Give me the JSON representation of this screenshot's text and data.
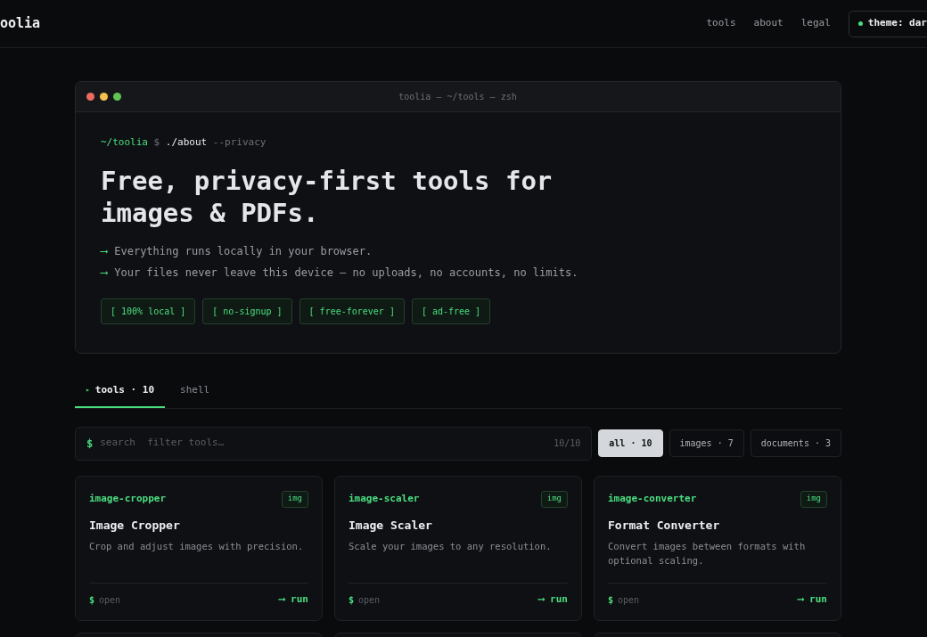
{
  "header": {
    "logo": "oolia",
    "nav": [
      {
        "label": "tools"
      },
      {
        "label": "about"
      },
      {
        "label": "legal"
      }
    ],
    "theme_button": {
      "label": "theme: dar"
    }
  },
  "terminal": {
    "title": "toolia — ~/tools — zsh",
    "prompt": {
      "path": "~/toolia",
      "symbol": "$",
      "command": "./about",
      "flag": "--privacy"
    },
    "headline": "Free, privacy-first tools for images & PDFs.",
    "bullets": [
      {
        "arrow": "⟶",
        "text": "Everything runs locally in your browser."
      },
      {
        "arrow": "⟶",
        "text": "Your files never leave this device — no uploads, no accounts, no limits."
      }
    ],
    "tags": [
      "[ 100% local ]",
      "[ no-signup ]",
      "[ free-forever ]",
      "[ ad-free ]"
    ]
  },
  "tabs": [
    {
      "marker": "▸",
      "label": "tools · 10",
      "selected": true
    },
    {
      "label": "shell",
      "selected": false
    }
  ],
  "search": {
    "prompt": "$",
    "placeholder": "search  filter tools…",
    "count": "10/10"
  },
  "filters": [
    {
      "label": "all · 10",
      "selected": true
    },
    {
      "label": "images · 7",
      "selected": false
    },
    {
      "label": "documents · 3",
      "selected": false
    }
  ],
  "cards": [
    {
      "slug": "image-cropper",
      "badge": "img",
      "title": "Image Cropper",
      "description": "Crop and adjust images with precision.",
      "open_prompt": "$",
      "open": "open",
      "run": "⟶ run"
    },
    {
      "slug": "image-scaler",
      "badge": "img",
      "title": "Image Scaler",
      "description": "Scale your images to any resolution.",
      "open_prompt": "$",
      "open": "open",
      "run": "⟶ run"
    },
    {
      "slug": "image-converter",
      "badge": "img",
      "title": "Format Converter",
      "description": "Convert images between formats with optional scaling.",
      "open_prompt": "$",
      "open": "open",
      "run": "⟶ run"
    }
  ]
}
